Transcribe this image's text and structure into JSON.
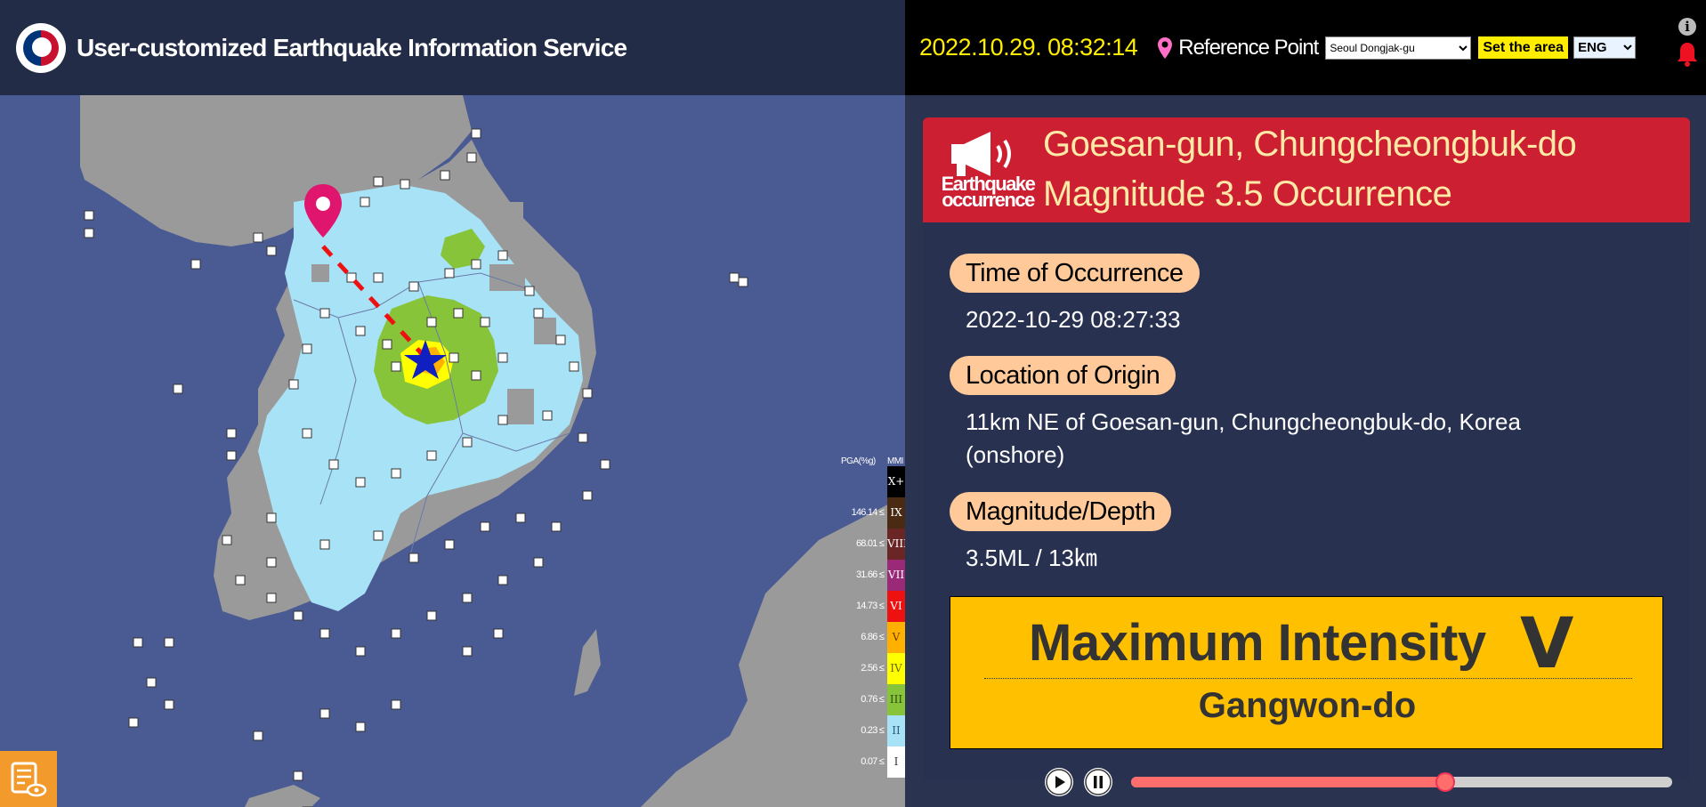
{
  "header": {
    "app_title": "User-customized Earthquake Information Service",
    "datetime": "2022.10.29. 08:32:14",
    "reference_point_label": "Reference Point",
    "reference_point_value": "Seoul Dongjak-gu",
    "set_area_label": "Set the area",
    "language": "ENG"
  },
  "alert": {
    "type_label_line1": "Earthquake",
    "type_label_line2": "occurrence",
    "location": "Goesan-gun, Chungcheongbuk-do",
    "magnitude_text": "Magnitude 3.5 Occurrence"
  },
  "details": {
    "time_label": "Time of Occurrence",
    "time_value": "2022-10-29 08:27:33",
    "location_label": "Location of Origin",
    "location_value_line1": "11km NE of Goesan-gun, Chungcheongbuk-do, Korea",
    "location_value_line2": "(onshore)",
    "magdepth_label": "Magnitude/Depth",
    "magdepth_value": "3.5ML / 13㎞"
  },
  "intensity": {
    "label": "Maximum Intensity",
    "value": "V",
    "region": "Gangwon-do"
  },
  "legend": {
    "pga_header": "PGA(%g)",
    "mmi_header": "MMI",
    "rows": [
      {
        "pga": "",
        "mmi": "X+",
        "color": "#000000",
        "text_color": "#ffffff"
      },
      {
        "pga": "146.14 ≤",
        "mmi": "IX",
        "color": "#4a2a12",
        "text_color": "#ffffff"
      },
      {
        "pga": "68.01 ≤",
        "mmi": "VIII",
        "color": "#6a2525",
        "text_color": "#ffffff"
      },
      {
        "pga": "31.66 ≤",
        "mmi": "VII",
        "color": "#9a2a78",
        "text_color": "#ffffff"
      },
      {
        "pga": "14.73 ≤",
        "mmi": "VI",
        "color": "#ee1111",
        "text_color": "#ffffff"
      },
      {
        "pga": "6.86 ≤",
        "mmi": "V",
        "color": "#ffb000",
        "text_color": "#6a4000"
      },
      {
        "pga": "2.56 ≤",
        "mmi": "IV",
        "color": "#ffff00",
        "text_color": "#6a6a00"
      },
      {
        "pga": "0.76 ≤",
        "mmi": "III",
        "color": "#88c43a",
        "text_color": "#2d4d10"
      },
      {
        "pga": "0.23 ≤",
        "mmi": "II",
        "color": "#a8e2f6",
        "text_color": "#2a5a7a"
      },
      {
        "pga": "0.07 ≤",
        "mmi": "I",
        "color": "#ffffff",
        "text_color": "#333333"
      }
    ]
  },
  "playback": {
    "progress": 0.58
  },
  "colors": {
    "alert_red": "#cc1f32",
    "intensity_yellow": "#ffc000",
    "pill_peach": "#ffc999",
    "datetime_yellow": "#ffee00"
  }
}
